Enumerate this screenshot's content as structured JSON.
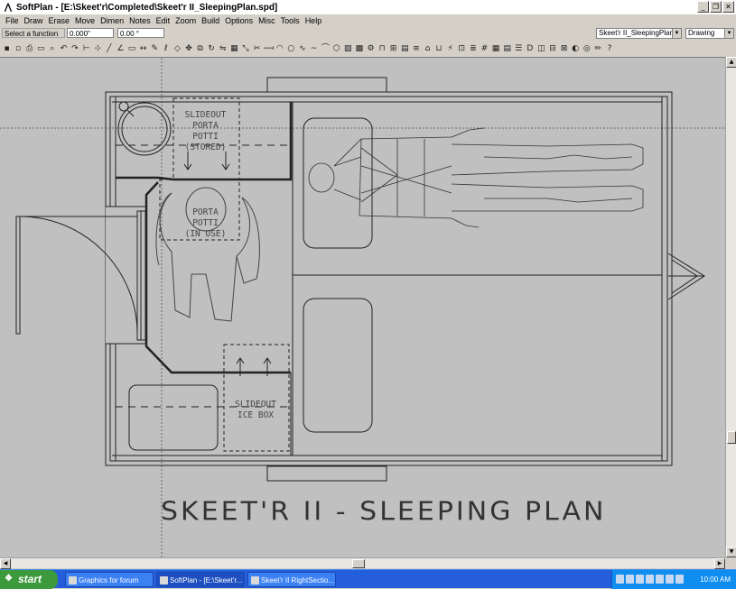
{
  "window": {
    "app_icon": "softplan-icon",
    "title": "SoftPlan - [E:\\Skeet'r\\Completed\\Skeet'r II_SleepingPlan.spd]"
  },
  "menu": [
    "File",
    "Draw",
    "Erase",
    "Move",
    "Dimen",
    "Notes",
    "Edit",
    "Zoom",
    "Build",
    "Options",
    "Misc",
    "Tools",
    "Help"
  ],
  "statusbar": {
    "function_prompt": "Select a function",
    "coord_x": "0.000\"",
    "coord_y": "0.00 °",
    "file_select": "Skeet'r II_SleepingPlan",
    "mode_select": "Drawing"
  },
  "toolbar_icons": [
    "save-icon",
    "open-icon",
    "print-icon",
    "preview-icon",
    "zoom-icon",
    "undo-icon",
    "redo-icon",
    "measure-icon",
    "snap-icon",
    "line-icon",
    "angle-icon",
    "wall-icon",
    "dimension-icon",
    "note-icon",
    "label-icon",
    "tag-icon",
    "move-icon",
    "copy-icon",
    "rotate-icon",
    "mirror-icon",
    "array-icon",
    "stretch-icon",
    "trim-icon",
    "extend-icon",
    "arc-icon",
    "circle-icon",
    "curve-icon",
    "bezier-icon",
    "fillet-icon",
    "polygon-icon",
    "hatch-icon",
    "pattern-icon",
    "symbol-icon",
    "door-icon",
    "window-icon",
    "cabinet-icon",
    "stair-icon",
    "roof-icon",
    "plumbing-icon",
    "electrical-icon",
    "furniture-icon",
    "layer-icon",
    "grid-icon",
    "table-icon",
    "report-icon",
    "list-icon",
    "text-icon",
    "view-icon",
    "section-icon",
    "elevation-icon",
    "render-icon",
    "camera-icon",
    "pencil-icon",
    "help-icon"
  ],
  "plan": {
    "labels": {
      "slideout_porta_potti": [
        "SLIDEOUT",
        "PORTA",
        "POTTI",
        "(STORED)"
      ],
      "porta_potti_in_use": [
        "PORTA",
        "POTTI",
        "(IN USE)"
      ],
      "slideout_ice_box": [
        "SLIDEOUT",
        "ICE BOX"
      ]
    },
    "title": "SKEET'R II - SLEEPING PLAN"
  },
  "taskbar": {
    "start_label": "start",
    "tasks": [
      {
        "label": "Graphics for forum",
        "active": false
      },
      {
        "label": "SoftPlan - [E:\\Skeet'r...",
        "active": true
      },
      {
        "label": "Skeet'r II RightSectio...",
        "active": false
      }
    ],
    "clock": "10:00 AM"
  }
}
